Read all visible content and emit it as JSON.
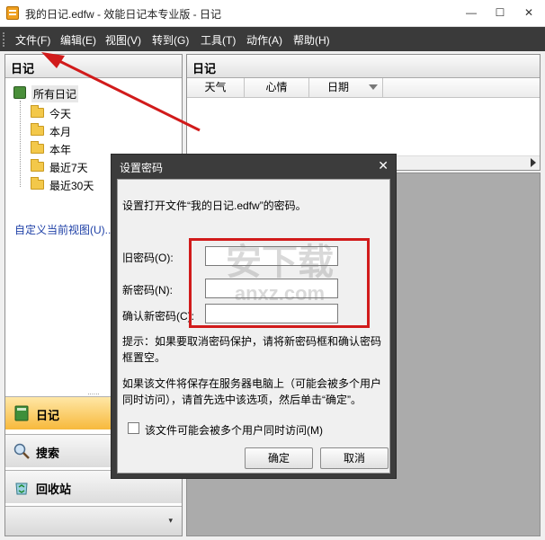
{
  "window": {
    "title": "我的日记.edfw - 效能日记本专业版 - 日记",
    "minimize": "—",
    "maximize": "☐",
    "close": "✕"
  },
  "menu": {
    "items": [
      "文件(F)",
      "编辑(E)",
      "视图(V)",
      "转到(G)",
      "工具(T)",
      "动作(A)",
      "帮助(H)"
    ]
  },
  "sidebar": {
    "header": "日记",
    "tree_root": "所有日记",
    "tree_items": [
      "今天",
      "本月",
      "本年",
      "最近7天",
      "最近30天"
    ],
    "custom_view_link": "自定义当前视图(U)...",
    "splitter": "......",
    "nav_buttons": [
      "日记",
      "搜索",
      "回收站"
    ],
    "nav_more": "▾"
  },
  "list_pane": {
    "header": "日记",
    "columns": [
      "天气",
      "心情",
      "日期"
    ]
  },
  "dialog": {
    "title": "设置密码",
    "close": "✕",
    "intro": "设置打开文件“我的日记.edfw”的密码。",
    "old_password_label": "旧密码(O):",
    "new_password_label": "新密码(N):",
    "confirm_password_label": "确认新密码(C):",
    "hint_line1": "提示：如果要取消密码保护，请将新密码框和确认密码",
    "hint_line2": "框置空。",
    "server_line1": "如果该文件将保存在服务器电脑上（可能会被多个用户",
    "server_line2": "同时访问），请首先选中该选项，然后单击“确定”。",
    "multiuser_checkbox": "该文件可能会被多个用户同时访问(M)",
    "multiuser_checked": false,
    "ok_button": "确定",
    "cancel_button": "取消"
  },
  "watermark": {
    "line1": "安下载",
    "line2": "anxz.com"
  },
  "colors": {
    "menubar": "#3a3a3a",
    "annotation_red": "#d11b1b",
    "active_nav": "#f7b93c",
    "link": "#1d3fa6"
  }
}
